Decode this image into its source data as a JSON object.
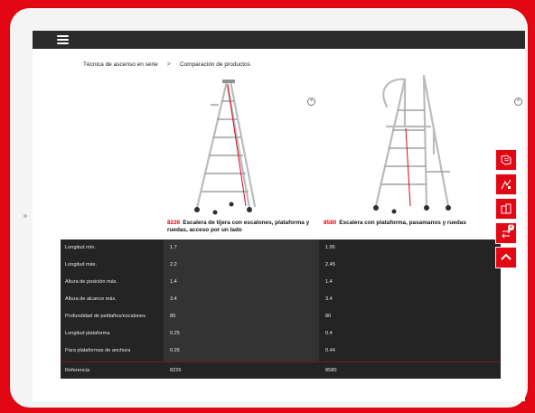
{
  "breadcrumb": {
    "item1": "Técnica de ascenso en serie",
    "separator": ">",
    "item2": "Comparación de productos"
  },
  "icons": {
    "menu": "hamburger-icon",
    "remove": "close-circle-icon",
    "tools": [
      "catalog-icon",
      "configurator-icon",
      "compare-layout-icon",
      "compare-swap-icon",
      "chevron-up-icon"
    ]
  },
  "products": [
    {
      "number": "8226",
      "title": "Escalera de tijera con escalones, plataforma y ruedas, acceso por un lado",
      "remove_symbol": "×"
    },
    {
      "number": "8580",
      "title": "Escalera con plataforma, pasamanos y ruedas",
      "remove_symbol": "×"
    }
  ],
  "specs": [
    {
      "label": "Longitud mín.",
      "v1": "1.7",
      "v2": "1.95"
    },
    {
      "label": "Longitud máx.",
      "v1": "2.2",
      "v2": "2.45"
    },
    {
      "label": "Altura de posición máx.",
      "v1": "1.4",
      "v2": "1.4"
    },
    {
      "label": "Altura de alcance máx.",
      "v1": "3.4",
      "v2": "3.4"
    },
    {
      "label": "Profundidad de peldaños/escalones",
      "v1": "80",
      "v2": "80"
    },
    {
      "label": "Longitud plataforma",
      "v1": "0.25",
      "v2": "0.4"
    },
    {
      "label": "Para plataformas de anchura",
      "v1": "0.25",
      "v2": "0.44"
    },
    {
      "label": "Referencia",
      "v1": "8226",
      "v2": "8580"
    }
  ],
  "compare_count": "2",
  "colors": {
    "brand": "#e30613",
    "table": "#242424",
    "topbar": "#2b2b2b"
  }
}
